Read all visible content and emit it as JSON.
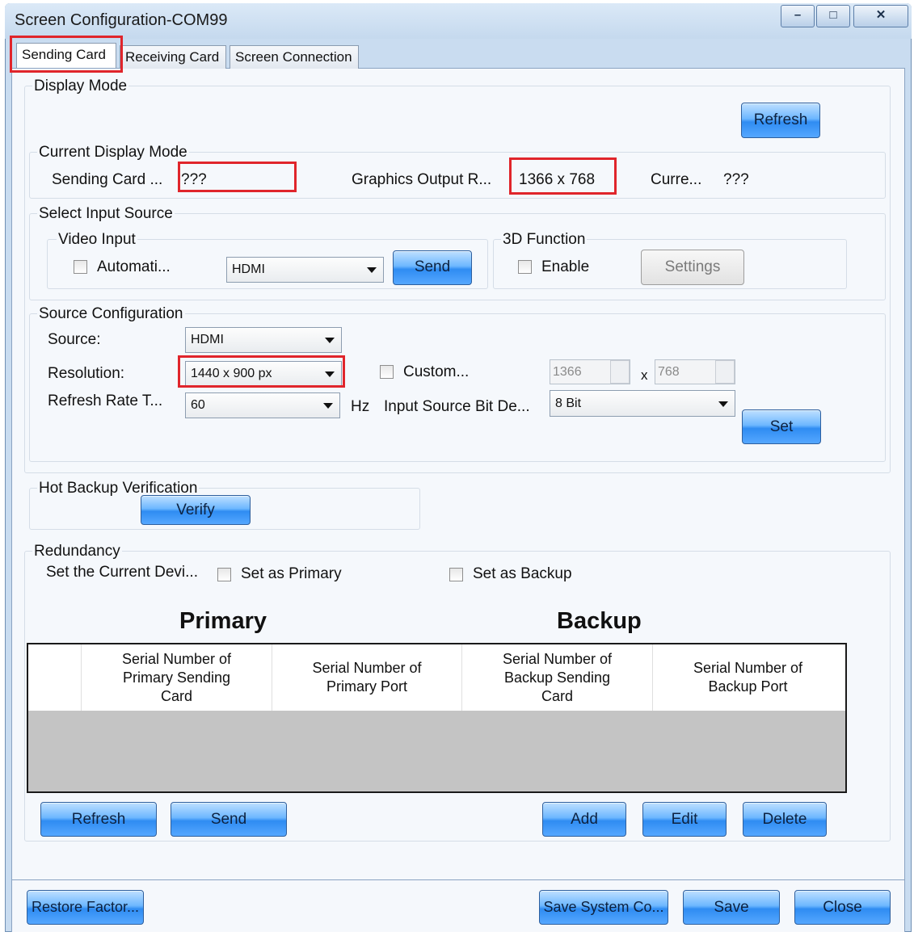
{
  "window": {
    "title": "Screen Configuration-COM99",
    "minimize": "–",
    "maximize": "□",
    "close": "✕"
  },
  "tabs": [
    "Sending Card",
    "Receiving Card",
    "Screen Connection"
  ],
  "display_mode": {
    "label": "Display Mode",
    "refresh": "Refresh",
    "current_label": "Current Display Mode",
    "sending_card_label": "Sending Card ...",
    "sending_card_value": "???",
    "graphics_output_label": "Graphics Output R...",
    "graphics_output_value": "1366 x 768",
    "current_label2": "Curre...",
    "current_value": "???"
  },
  "input_source": {
    "label": "Select Input Source",
    "video_input_label": "Video Input",
    "automatic_label": "Automati...",
    "video_select": "HDMI",
    "send": "Send",
    "function3d_label": "3D Function",
    "enable_label": "Enable",
    "settings": "Settings"
  },
  "source_config": {
    "label": "Source Configuration",
    "source_label": "Source:",
    "source_value": "HDMI",
    "resolution_label": "Resolution:",
    "resolution_value": "1440 x 900 px",
    "custom_label": "Custom...",
    "width_value": "1366",
    "times": "x",
    "height_value": "768",
    "refresh_rate_label": "Refresh Rate T...",
    "refresh_rate_value": "60",
    "hz": "Hz",
    "bit_depth_label": "Input Source Bit De...",
    "bit_depth_value": "8 Bit",
    "set": "Set"
  },
  "hot_backup": {
    "label": "Hot Backup Verification",
    "verify": "Verify"
  },
  "redundancy": {
    "label": "Redundancy",
    "set_current_label": "Set the Current Devi...",
    "set_primary": "Set as Primary",
    "set_backup": "Set as Backup",
    "primary_heading": "Primary",
    "backup_heading": "Backup",
    "columns": [
      "Serial Number of Primary Sending Card",
      "Serial Number of Primary Port",
      "Serial Number of Backup Sending Card",
      "Serial Number of Backup Port"
    ],
    "refresh": "Refresh",
    "send": "Send",
    "add": "Add",
    "edit": "Edit",
    "delete": "Delete"
  },
  "footer": {
    "restore": "Restore Factor...",
    "save_system": "Save System Co...",
    "save": "Save",
    "close": "Close"
  }
}
